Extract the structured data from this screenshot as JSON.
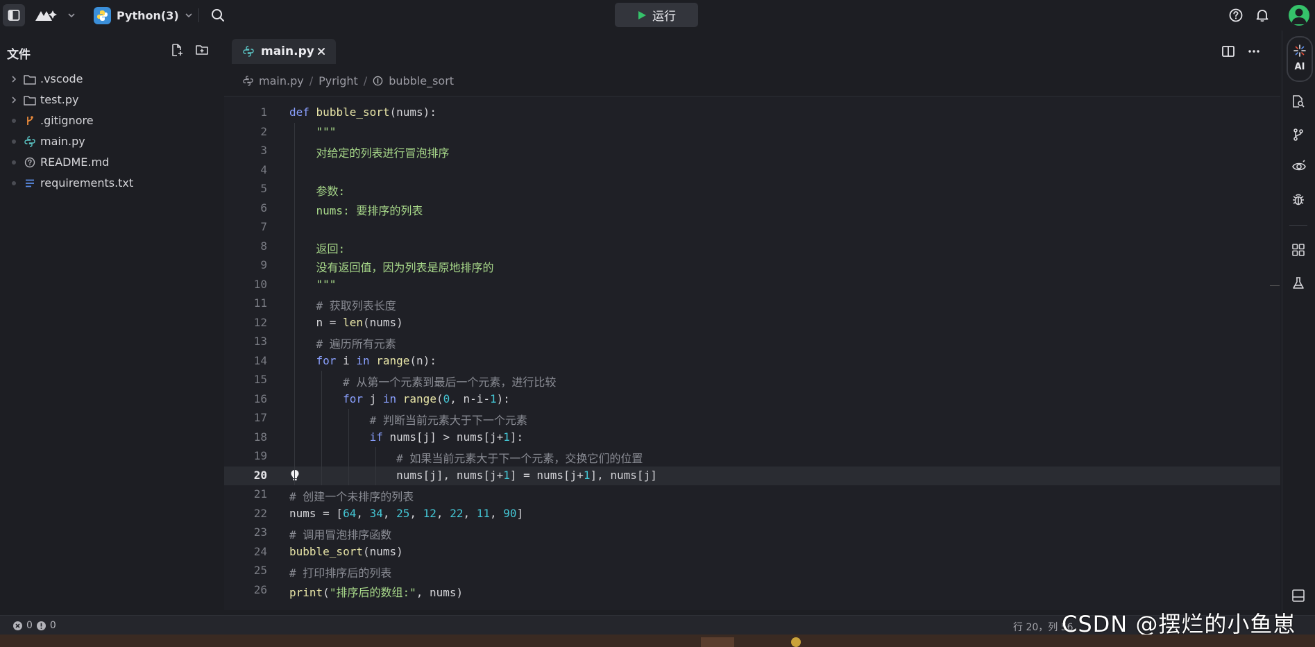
{
  "topbar": {
    "project_name": "Python(3)",
    "run_label": "运行"
  },
  "sidebar": {
    "title": "文件",
    "items": [
      {
        "label": ".vscode",
        "icon": "folder-icon",
        "marker": "chevron"
      },
      {
        "label": "test.py",
        "icon": "folder-icon",
        "marker": "chevron"
      },
      {
        "label": ".gitignore",
        "icon": "git-branch-icon",
        "marker": "dot"
      },
      {
        "label": "main.py",
        "icon": "python-file-icon",
        "marker": "dot"
      },
      {
        "label": "README.md",
        "icon": "help-circle-icon",
        "marker": "dot"
      },
      {
        "label": "requirements.txt",
        "icon": "text-lines-icon",
        "marker": "dot"
      }
    ]
  },
  "editor": {
    "tab_label": "main.py",
    "breadcrumb": [
      "main.py",
      "Pyright",
      "bubble_sort"
    ],
    "active_line": 20,
    "lines": [
      {
        "n": "1",
        "text": "def bubble_sort(nums):"
      },
      {
        "n": "2",
        "text": "    \"\"\""
      },
      {
        "n": "3",
        "text": "    对给定的列表进行冒泡排序"
      },
      {
        "n": "4",
        "text": ""
      },
      {
        "n": "5",
        "text": "    参数:"
      },
      {
        "n": "6",
        "text": "    nums: 要排序的列表"
      },
      {
        "n": "7",
        "text": ""
      },
      {
        "n": "8",
        "text": "    返回:"
      },
      {
        "n": "9",
        "text": "    没有返回值，因为列表是原地排序的"
      },
      {
        "n": "10",
        "text": "    \"\"\""
      },
      {
        "n": "11",
        "text": "    # 获取列表长度"
      },
      {
        "n": "12",
        "text": "    n = len(nums)"
      },
      {
        "n": "13",
        "text": "    # 遍历所有元素"
      },
      {
        "n": "14",
        "text": "    for i in range(n):"
      },
      {
        "n": "15",
        "text": "        # 从第一个元素到最后一个元素，进行比较"
      },
      {
        "n": "16",
        "text": "        for j in range(0, n-i-1):"
      },
      {
        "n": "17",
        "text": "            # 判断当前元素大于下一个元素"
      },
      {
        "n": "18",
        "text": "            if nums[j] > nums[j+1]:"
      },
      {
        "n": "19",
        "text": "                # 如果当前元素大于下一个元素，交换它们的位置"
      },
      {
        "n": "20",
        "text": "                nums[j], nums[j+1] = nums[j+1], nums[j]"
      },
      {
        "n": "21",
        "text": "# 创建一个未排序的列表"
      },
      {
        "n": "22",
        "text": "nums = [64, 34, 25, 12, 22, 11, 90]"
      },
      {
        "n": "23",
        "text": "# 调用冒泡排序函数"
      },
      {
        "n": "24",
        "text": "bubble_sort(nums)"
      },
      {
        "n": "25",
        "text": "# 打印排序后的列表"
      },
      {
        "n": "26",
        "text": "print(\"排序后的数组:\", nums)"
      }
    ]
  },
  "rightbar": {
    "ai_label": "AI"
  },
  "statusbar": {
    "errors": "0",
    "warnings": "0",
    "position": "行 20，列 56"
  },
  "watermark": "CSDN @摆烂的小鱼崽",
  "colors": {
    "background": "#1d1e23",
    "editor_bg": "#1f2026",
    "keyword": "#8aa0ff",
    "function": "#e9e6a8",
    "number": "#44c7d6",
    "string": "#a8d98a",
    "comment": "#8a8c94",
    "accent_green": "#35c26a",
    "python_badge": "#3b8fd9"
  }
}
